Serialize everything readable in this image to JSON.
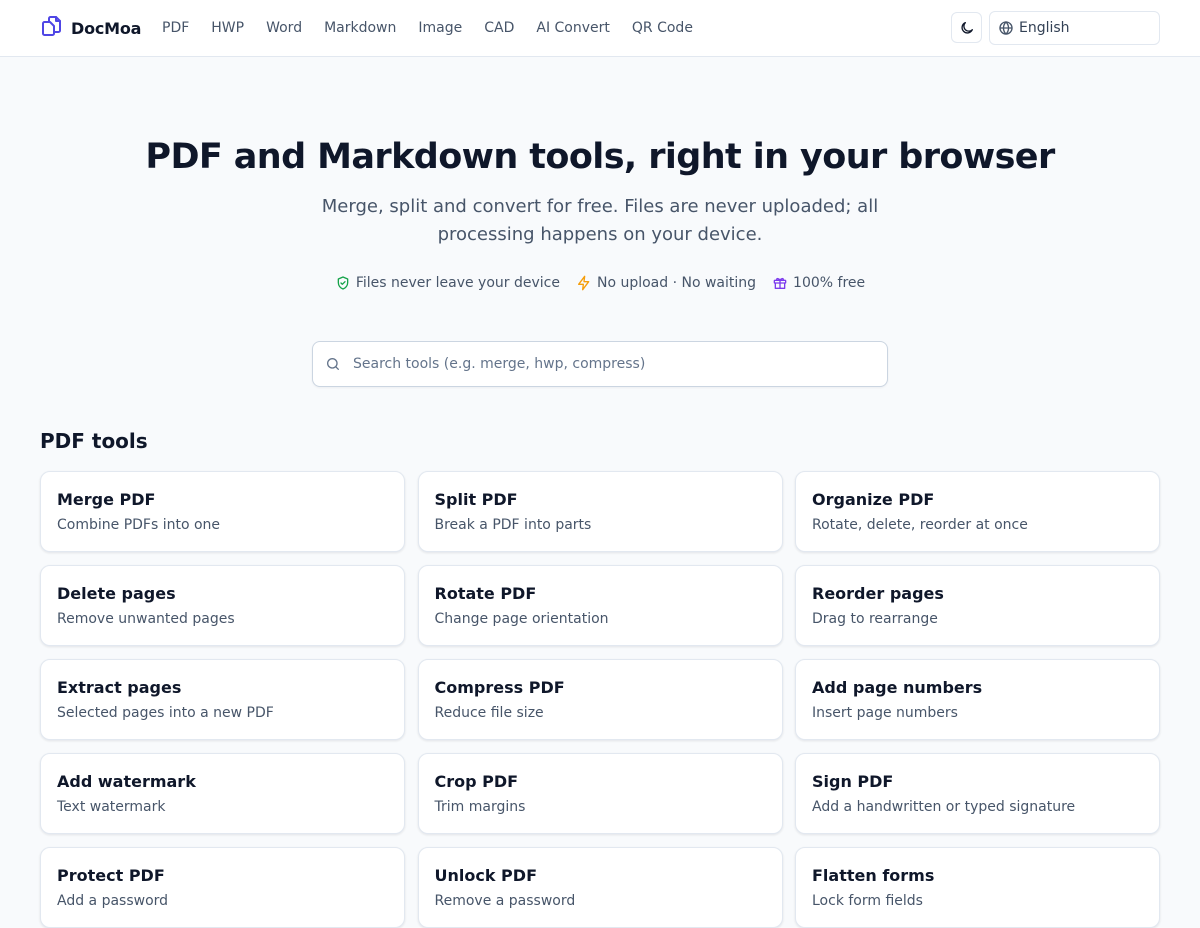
{
  "header": {
    "brand": "DocMoa",
    "nav": [
      "PDF",
      "HWP",
      "Word",
      "Markdown",
      "Image",
      "CAD",
      "AI Convert",
      "QR Code"
    ],
    "theme_icon": "moon-icon",
    "language": {
      "icon": "globe-icon",
      "selected": "English"
    }
  },
  "hero": {
    "title": "PDF and Markdown tools, right in your browser",
    "subtitle": "Merge, split and convert for free. Files are never uploaded; all processing happens on your device.",
    "badges": [
      {
        "icon": "shield-check-icon",
        "color": "#16a34a",
        "text": "Files never leave your device"
      },
      {
        "icon": "lightning-icon",
        "color": "#f59e0b",
        "text": "No upload · No waiting"
      },
      {
        "icon": "gift-icon",
        "color": "#7c3aed",
        "text": "100% free"
      }
    ]
  },
  "search": {
    "icon": "search-icon",
    "placeholder": "Search tools (e.g. merge, hwp, compress)",
    "value": ""
  },
  "pdf_tools": {
    "title": "PDF tools",
    "cards": [
      {
        "title": "Merge PDF",
        "desc": "Combine PDFs into one"
      },
      {
        "title": "Split PDF",
        "desc": "Break a PDF into parts"
      },
      {
        "title": "Organize PDF",
        "desc": "Rotate, delete, reorder at once"
      },
      {
        "title": "Delete pages",
        "desc": "Remove unwanted pages"
      },
      {
        "title": "Rotate PDF",
        "desc": "Change page orientation"
      },
      {
        "title": "Reorder pages",
        "desc": "Drag to rearrange"
      },
      {
        "title": "Extract pages",
        "desc": "Selected pages into a new PDF"
      },
      {
        "title": "Compress PDF",
        "desc": "Reduce file size"
      },
      {
        "title": "Add page numbers",
        "desc": "Insert page numbers"
      },
      {
        "title": "Add watermark",
        "desc": "Text watermark"
      },
      {
        "title": "Crop PDF",
        "desc": "Trim margins"
      },
      {
        "title": "Sign PDF",
        "desc": "Add a handwritten or typed signature"
      },
      {
        "title": "Protect PDF",
        "desc": "Add a password"
      },
      {
        "title": "Unlock PDF",
        "desc": "Remove a password"
      },
      {
        "title": "Flatten forms",
        "desc": "Lock form fields"
      }
    ]
  },
  "colors": {
    "brand": "#4f46e5",
    "background": "#f8fafc",
    "text": "#0f172a",
    "muted": "#475569"
  }
}
